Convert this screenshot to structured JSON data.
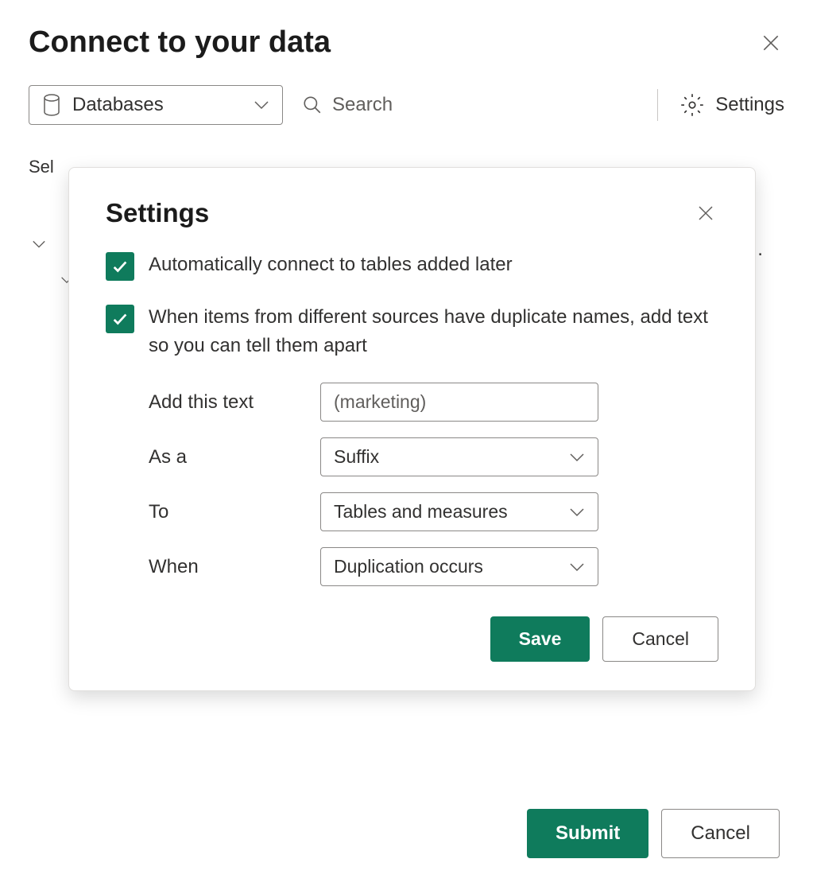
{
  "page": {
    "title": "Connect to your data",
    "select_label": "Sel"
  },
  "toolbar": {
    "dropdown_label": "Databases",
    "search_placeholder": "Search",
    "settings_label": "Settings"
  },
  "modal": {
    "title": "Settings",
    "checkbox1_label": "Automatically connect to tables added later",
    "checkbox2_label": "When items from different sources have duplicate names, add text so you can tell them apart",
    "form": {
      "add_text_label": "Add this text",
      "add_text_value": "(marketing)",
      "as_a_label": "As a",
      "as_a_value": "Suffix",
      "to_label": "To",
      "to_value": "Tables and measures",
      "when_label": "When",
      "when_value": "Duplication occurs"
    },
    "save_label": "Save",
    "cancel_label": "Cancel"
  },
  "footer": {
    "submit_label": "Submit",
    "cancel_label": "Cancel"
  }
}
